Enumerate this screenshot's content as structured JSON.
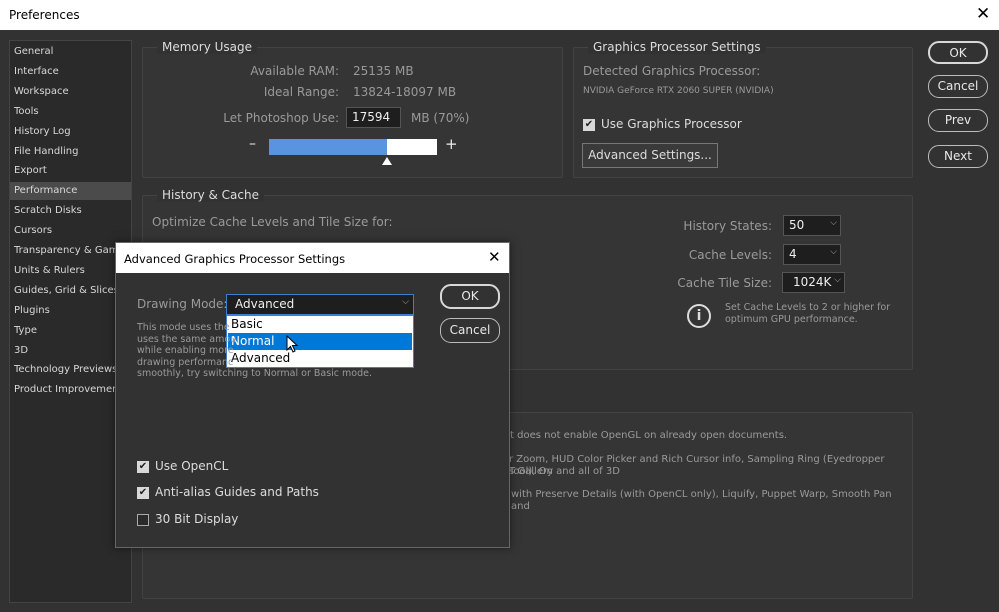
{
  "window": {
    "title": "Preferences",
    "close": "✕"
  },
  "sidebar": {
    "items": [
      "General",
      "Interface",
      "Workspace",
      "Tools",
      "History Log",
      "File Handling",
      "Export",
      "Performance",
      "Scratch Disks",
      "Cursors",
      "Transparency & Gamut",
      "Units & Rulers",
      "Guides, Grid & Slices",
      "Plugins",
      "Type",
      "3D",
      "Technology Previews",
      "Product Improvement"
    ],
    "selected": "Performance"
  },
  "buttons": {
    "ok": "OK",
    "cancel": "Cancel",
    "prev": "Prev",
    "next": "Next"
  },
  "memory": {
    "title": "Memory Usage",
    "available_label": "Available RAM:",
    "available_value": "25135 MB",
    "ideal_label": "Ideal Range:",
    "ideal_value": "13824-18097 MB",
    "use_label": "Let Photoshop Use:",
    "use_value": "17594",
    "use_unit": "MB (70%)",
    "minus": "–",
    "plus": "+",
    "slider_percent": 70
  },
  "gpu": {
    "title": "Graphics Processor Settings",
    "detected_label": "Detected Graphics Processor:",
    "detected_value": "NVIDIA GeForce RTX 2060 SUPER (NVIDIA)",
    "use_gpu_label": "Use Graphics Processor",
    "use_gpu_checked": true,
    "advanced_button": "Advanced Settings..."
  },
  "history": {
    "title": "History & Cache",
    "optimize_label": "Optimize Cache Levels and Tile Size for:",
    "history_states_label": "History States:",
    "history_states_value": "50",
    "cache_levels_label": "Cache Levels:",
    "cache_levels_value": "4",
    "tile_size_label": "Cache Tile Size:",
    "tile_size_value": "1024K",
    "info_text": "Set Cache Levels to 2 or higher for optimum GPU performance."
  },
  "bottom": {
    "lines": [
      "t does not enable OpenGL on already open documents.",
      "r Zoom, HUD Color Picker and Rich Cursor info, Sampling Ring (Eyedropper Tool), On",
      "s Gallery and all of 3D",
      "with Preserve Details (with OpenCL only), Liquify, Puppet Warp, Smooth Pan and"
    ]
  },
  "dialog": {
    "title": "Advanced Graphics Processor Settings",
    "close": "✕",
    "drawing_mode_label": "Drawing Mode:",
    "drawing_mode_value": "Advanced",
    "options": [
      "Basic",
      "Normal",
      "Advanced"
    ],
    "highlighted": "Normal",
    "ok": "OK",
    "cancel": "Cancel",
    "desc_lines": [
      "This mode uses the",
      "uses the same amou",
      "while enabling more",
      "drawing performanc",
      "smoothly, try switching to Normal or Basic mode."
    ],
    "use_opencl": "Use OpenCL",
    "use_opencl_checked": true,
    "antialias": "Anti-alias Guides and Paths",
    "antialias_checked": true,
    "bit30": "30 Bit Display",
    "bit30_checked": false
  }
}
